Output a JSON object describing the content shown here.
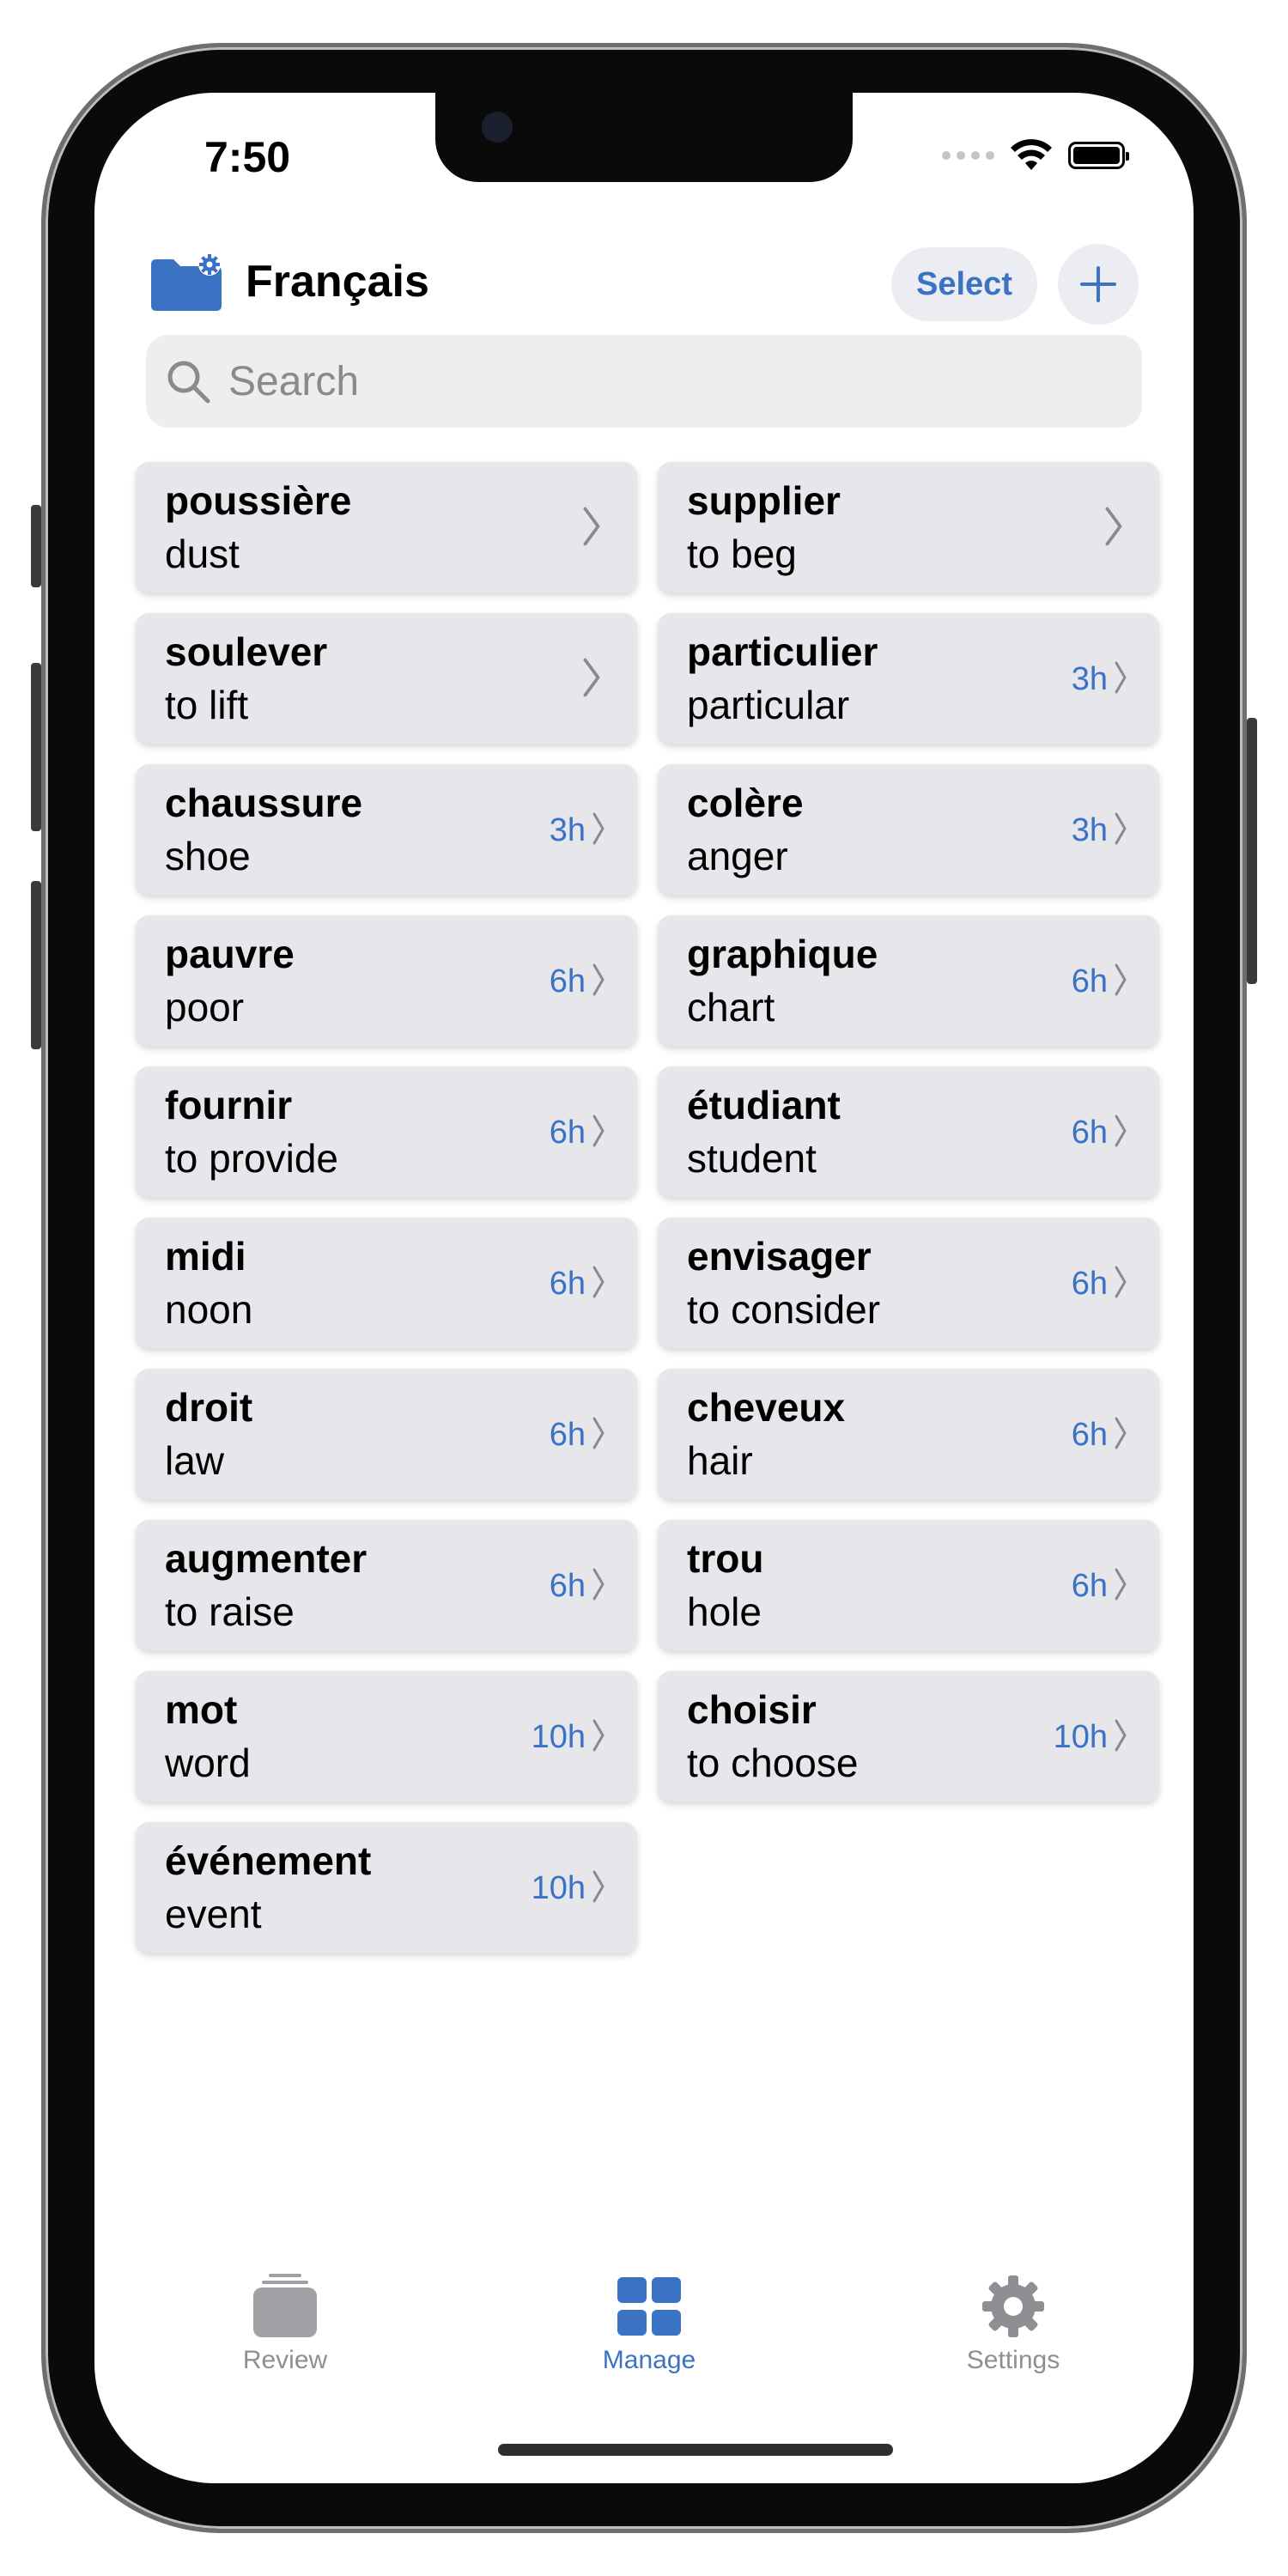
{
  "status": {
    "time": "7:50"
  },
  "header": {
    "title": "Français",
    "select_label": "Select"
  },
  "search": {
    "placeholder": "Search"
  },
  "colors": {
    "accent": "#3b73c4",
    "card_bg": "#e6e6eb",
    "inactive": "#8e8e93"
  },
  "cards": [
    {
      "term": "poussière",
      "meaning": "dust",
      "due": ""
    },
    {
      "term": "supplier",
      "meaning": "to beg",
      "due": ""
    },
    {
      "term": "soulever",
      "meaning": "to lift",
      "due": ""
    },
    {
      "term": "particulier",
      "meaning": "particular",
      "due": "3h"
    },
    {
      "term": "chaussure",
      "meaning": "shoe",
      "due": "3h"
    },
    {
      "term": "colère",
      "meaning": "anger",
      "due": "3h"
    },
    {
      "term": "pauvre",
      "meaning": "poor",
      "due": "6h"
    },
    {
      "term": "graphique",
      "meaning": "chart",
      "due": "6h"
    },
    {
      "term": "fournir",
      "meaning": "to provide",
      "due": "6h"
    },
    {
      "term": "étudiant",
      "meaning": "student",
      "due": "6h"
    },
    {
      "term": "midi",
      "meaning": "noon",
      "due": "6h"
    },
    {
      "term": "envisager",
      "meaning": "to consider",
      "due": "6h"
    },
    {
      "term": "droit",
      "meaning": "law",
      "due": "6h"
    },
    {
      "term": "cheveux",
      "meaning": "hair",
      "due": "6h"
    },
    {
      "term": "augmenter",
      "meaning": "to raise",
      "due": "6h"
    },
    {
      "term": "trou",
      "meaning": "hole",
      "due": "6h"
    },
    {
      "term": "mot",
      "meaning": "word",
      "due": "10h"
    },
    {
      "term": "choisir",
      "meaning": "to choose",
      "due": "10h"
    },
    {
      "term": "événement",
      "meaning": "event",
      "due": "10h"
    }
  ],
  "tabs": [
    {
      "label": "Review",
      "icon": "stack-icon",
      "active": false
    },
    {
      "label": "Manage",
      "icon": "grid-icon",
      "active": true
    },
    {
      "label": "Settings",
      "icon": "gear-icon",
      "active": false
    }
  ]
}
